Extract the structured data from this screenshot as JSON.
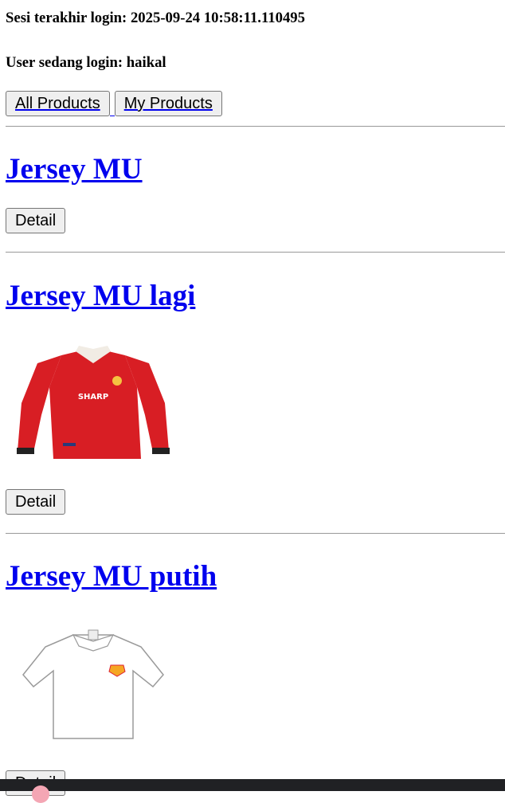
{
  "session": {
    "last_login_label": "Sesi terakhir login: 2025-09-24 10:58:11.110495",
    "user_label": "User sedang login: haikal"
  },
  "nav": {
    "all_products": "All Products",
    "my_products": "My Products"
  },
  "products": [
    {
      "name": "Jersey MU",
      "detail_label": "Detail",
      "image": "none"
    },
    {
      "name": "Jersey MU lagi",
      "detail_label": "Detail",
      "image": "red-long-sleeve-jersey",
      "sponsor_text": "SHARP"
    },
    {
      "name": "Jersey MU putih",
      "detail_label": "Detail",
      "image": "white-short-sleeve-jersey"
    }
  ],
  "colors": {
    "link": "#0000ee",
    "jersey_red": "#d81e24",
    "jersey_white": "#ffffff"
  }
}
